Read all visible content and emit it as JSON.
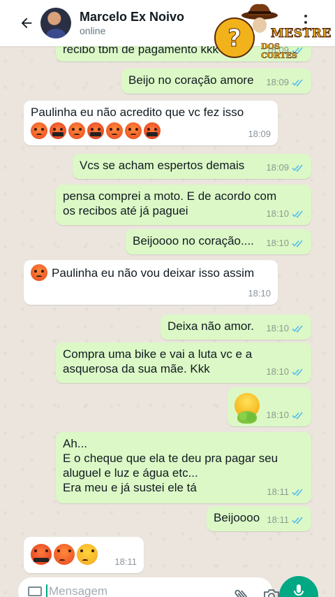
{
  "header": {
    "contact_name": "Marcelo Ex Noivo",
    "status": "online"
  },
  "watermark": {
    "line1": "MESTRE",
    "line2": "DOS CORTES"
  },
  "colors": {
    "outgoing_bubble": "#dcf8c6",
    "incoming_bubble": "#ffffff",
    "read_ticks": "#53bdeb",
    "accent": "#00a884"
  },
  "messages": [
    {
      "direction": "out",
      "text": "recibo tbm de pagamento kkk",
      "time": "18:09",
      "status_icon": "double-check-read"
    },
    {
      "direction": "out",
      "text": "Beijo no coração amore",
      "time": "18:09",
      "status_icon": "double-check-read"
    },
    {
      "direction": "in",
      "text": "Paulinha eu não acredito que vc fez isso",
      "time": "18:09",
      "emojis": [
        "angry-face",
        "cursing-face",
        "angry-face",
        "cursing-face",
        "angry-face",
        "angry-face",
        "cursing-face"
      ]
    },
    {
      "direction": "out",
      "text": "Vcs se acham espertos demais",
      "time": "18:09",
      "status_icon": "double-check-read"
    },
    {
      "direction": "out",
      "text": "pensa comprei a moto. E de acordo com\nos recibos até já paguei",
      "time": "18:10",
      "status_icon": "double-check-read"
    },
    {
      "direction": "out",
      "text": "Beijoooo no coração....",
      "time": "18:10",
      "status_icon": "double-check-read"
    },
    {
      "direction": "in",
      "text": "Paulinha eu não vou deixar isso assim",
      "time": "18:10",
      "emojis": [
        "angry-face"
      ]
    },
    {
      "direction": "out",
      "text": "Deixa não amor.",
      "time": "18:10",
      "status_icon": "double-check-read"
    },
    {
      "direction": "out",
      "text": "Compra uma bike e vai a luta vc e a\nasquerosa da sua mãe. Kkk",
      "time": "18:10",
      "status_icon": "double-check-read"
    },
    {
      "direction": "out",
      "text": "",
      "time": "18:10",
      "status_icon": "double-check-read",
      "emojis": [
        "vomiting-face"
      ]
    },
    {
      "direction": "out",
      "text": "Ah...\nE o cheque que ela te deu pra pagar seu\naluguel e luz e água etc...\nEra meu e já sustei ele tá",
      "time": "18:11",
      "status_icon": "double-check-read"
    },
    {
      "direction": "out",
      "text": "Beijoooo",
      "time": "18:11",
      "status_icon": "double-check-read"
    },
    {
      "direction": "in",
      "text": "",
      "time": "18:11",
      "emojis": [
        "cursing-face",
        "angry-face",
        "angry-yellow-face"
      ]
    }
  ],
  "composer": {
    "placeholder": "Mensagem"
  }
}
